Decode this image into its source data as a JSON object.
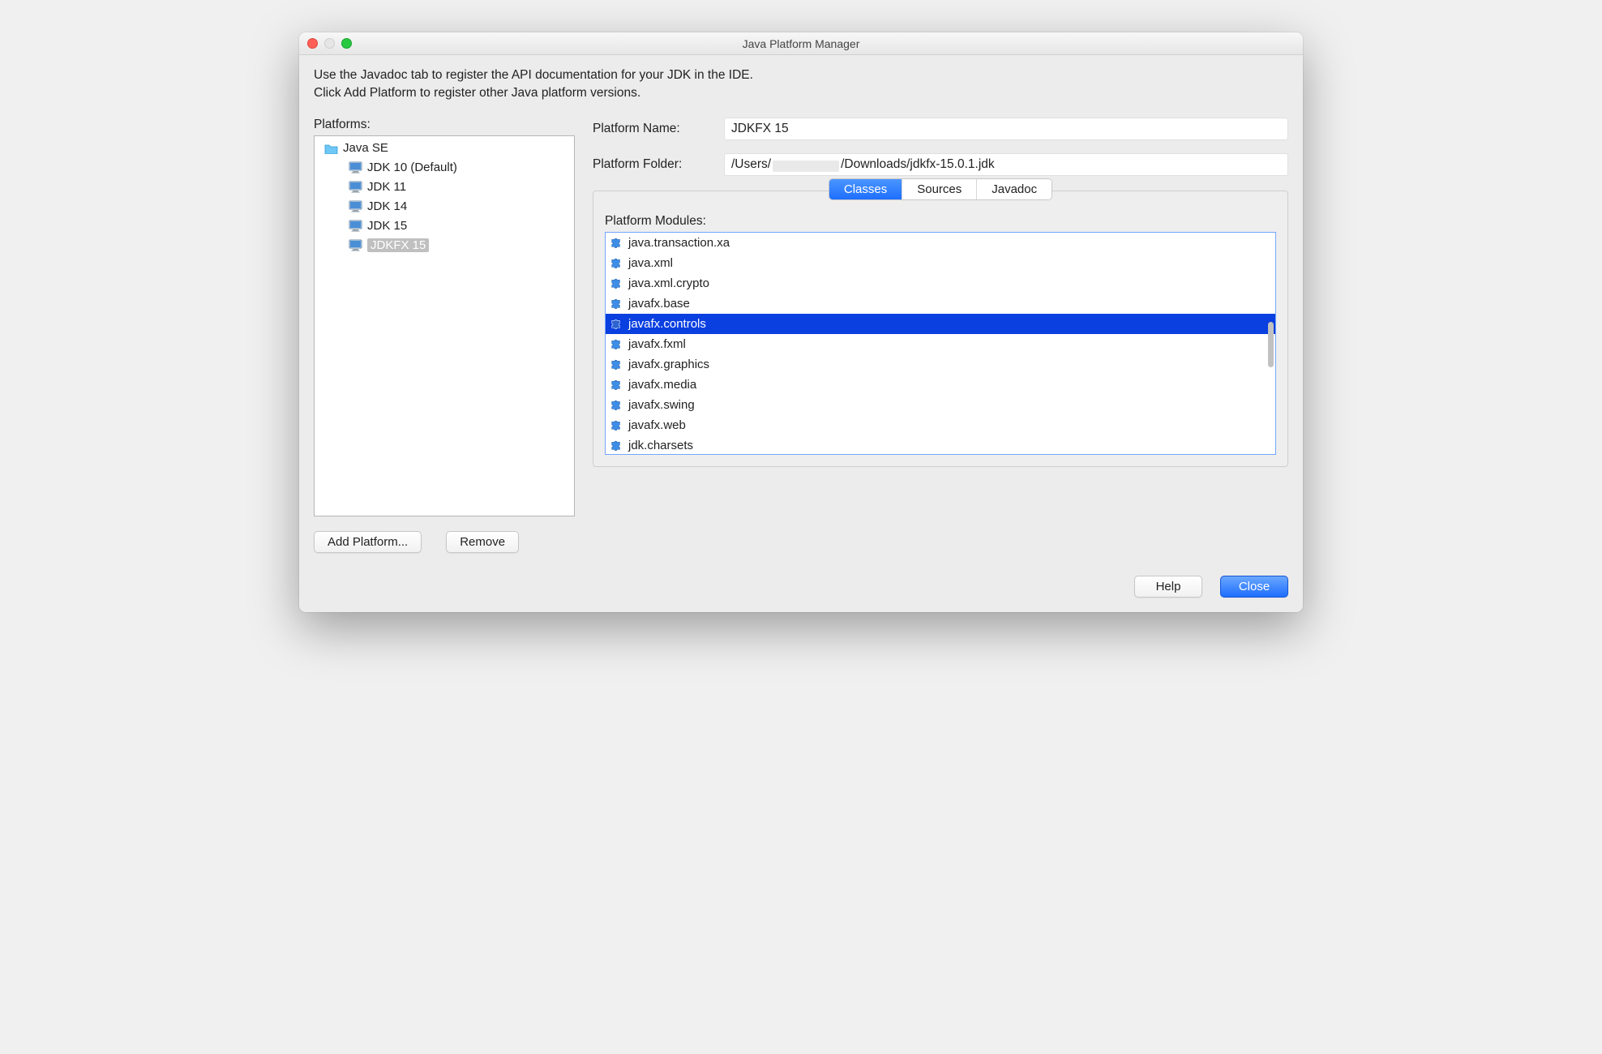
{
  "window": {
    "title": "Java Platform Manager"
  },
  "hint": {
    "line1": "Use the Javadoc tab to register the API documentation for your JDK in the IDE.",
    "line2": "Click Add Platform to register other Java platform versions."
  },
  "left": {
    "label": "Platforms:",
    "root": "Java SE",
    "items": [
      {
        "label": "JDK 10 (Default)"
      },
      {
        "label": "JDK 11"
      },
      {
        "label": "JDK 14"
      },
      {
        "label": "JDK 15"
      },
      {
        "label": "JDKFX 15",
        "selected": true
      }
    ],
    "addButton": "Add Platform...",
    "removeButton": "Remove"
  },
  "right": {
    "nameLabel": "Platform Name:",
    "nameValue": "JDKFX 15",
    "folderLabel": "Platform Folder:",
    "folderParts": {
      "pre": "/Users/",
      "post": "/Downloads/jdkfx-15.0.1.jdk"
    },
    "tabs": [
      {
        "label": "Classes",
        "active": true
      },
      {
        "label": "Sources"
      },
      {
        "label": "Javadoc"
      }
    ],
    "modulesLabel": "Platform Modules:",
    "modules": [
      {
        "name": "java.transaction.xa"
      },
      {
        "name": "java.xml"
      },
      {
        "name": "java.xml.crypto"
      },
      {
        "name": "javafx.base"
      },
      {
        "name": "javafx.controls",
        "selected": true
      },
      {
        "name": "javafx.fxml"
      },
      {
        "name": "javafx.graphics"
      },
      {
        "name": "javafx.media"
      },
      {
        "name": "javafx.swing"
      },
      {
        "name": "javafx.web"
      },
      {
        "name": "jdk.charsets"
      }
    ]
  },
  "footer": {
    "help": "Help",
    "close": "Close"
  }
}
